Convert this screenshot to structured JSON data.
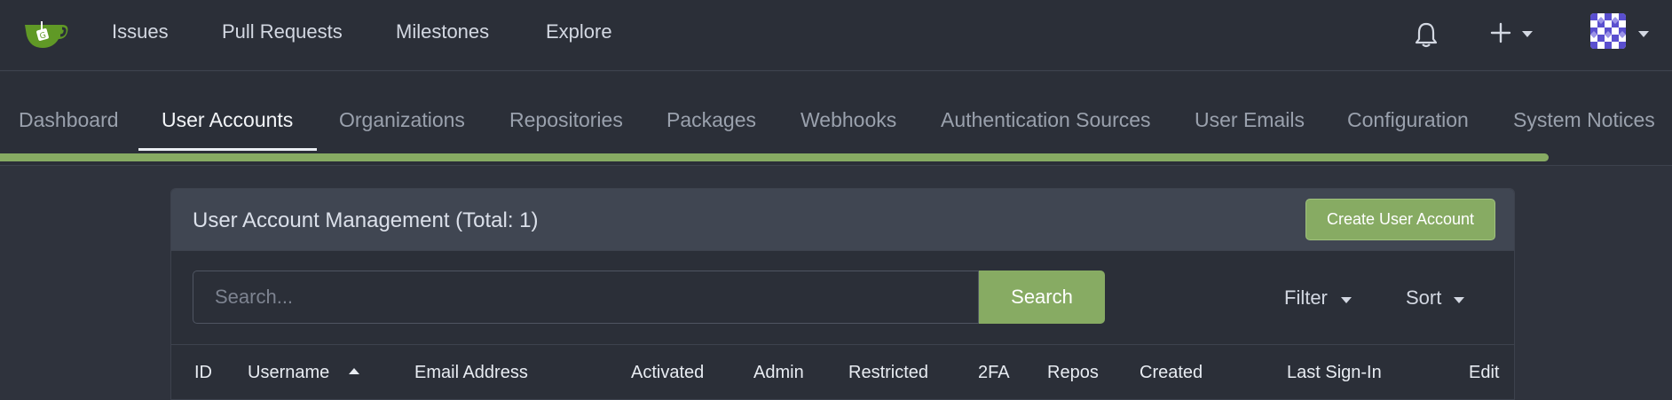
{
  "topnav": {
    "items": [
      {
        "label": "Issues"
      },
      {
        "label": "Pull Requests"
      },
      {
        "label": "Milestones"
      },
      {
        "label": "Explore"
      }
    ],
    "icons": {
      "logo": "gitea-teacup-logo",
      "notifications": "bell-icon",
      "create": "plus-icon",
      "avatar": "user-avatar"
    }
  },
  "admin_tabs": {
    "items": [
      {
        "label": "Dashboard",
        "active": false
      },
      {
        "label": "User Accounts",
        "active": true
      },
      {
        "label": "Organizations",
        "active": false
      },
      {
        "label": "Repositories",
        "active": false
      },
      {
        "label": "Packages",
        "active": false
      },
      {
        "label": "Webhooks",
        "active": false
      },
      {
        "label": "Authentication Sources",
        "active": false
      },
      {
        "label": "User Emails",
        "active": false
      },
      {
        "label": "Configuration",
        "active": false
      },
      {
        "label": "System Notices",
        "active": false
      }
    ],
    "page_load_progress": 0.926
  },
  "panel": {
    "title": "User Account Management (Total: 1)",
    "create_button": "Create User Account",
    "search": {
      "placeholder": "Search...",
      "value": "",
      "button": "Search"
    },
    "filter_label": "Filter",
    "sort_label": "Sort",
    "table": {
      "columns": [
        "ID",
        "Username",
        "Email Address",
        "Activated",
        "Admin",
        "Restricted",
        "2FA",
        "Repos",
        "Created",
        "Last Sign-In",
        "Edit"
      ],
      "sorted_column": "Username",
      "sort_direction": "ascending"
    }
  },
  "colors": {
    "accent": "#87ab63",
    "background": "#2f333d",
    "nav_background": "#2b2f38",
    "panel_header": "#404652",
    "text": "#dbe0ea",
    "muted_text": "#9aa1ad"
  }
}
